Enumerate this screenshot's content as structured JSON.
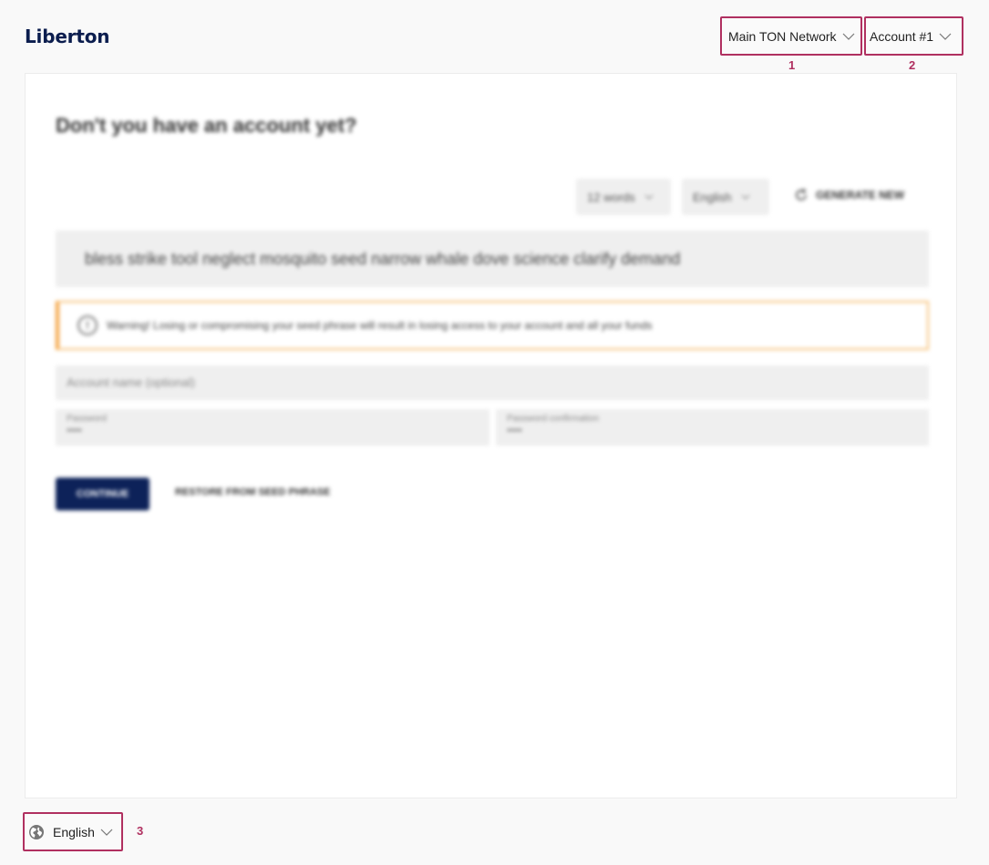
{
  "app": {
    "title": "Liberton"
  },
  "header": {
    "network_select": {
      "value": "Main TON Network",
      "marker": "1"
    },
    "account_select": {
      "value": "Account #1",
      "marker": "2"
    }
  },
  "card": {
    "heading": "Don't you have an account yet?",
    "word_count_select": "12 words",
    "seed_language_select": "English",
    "generate_label": "GENERATE NEW",
    "seed_phrase": "bless strike tool neglect mosquito seed narrow whale dove science clarify demand",
    "warning": "Warning! Losing or compromising your seed phrase will result in losing access to your account and all your funds",
    "account_name_placeholder": "Account name (optional)",
    "password_label": "Password",
    "password_value": "••••",
    "password_confirm_label": "Password confirmation",
    "password_confirm_value": "••••",
    "continue_label": "CONTINUE",
    "restore_label": "RESTORE FROM SEED PHRASE"
  },
  "footer": {
    "language_select": {
      "value": "English",
      "marker": "3"
    }
  },
  "colors": {
    "accent_outline": "#b03060",
    "brand": "#0b1d4e",
    "button": "#0d2259",
    "warning": "#f5a442"
  }
}
